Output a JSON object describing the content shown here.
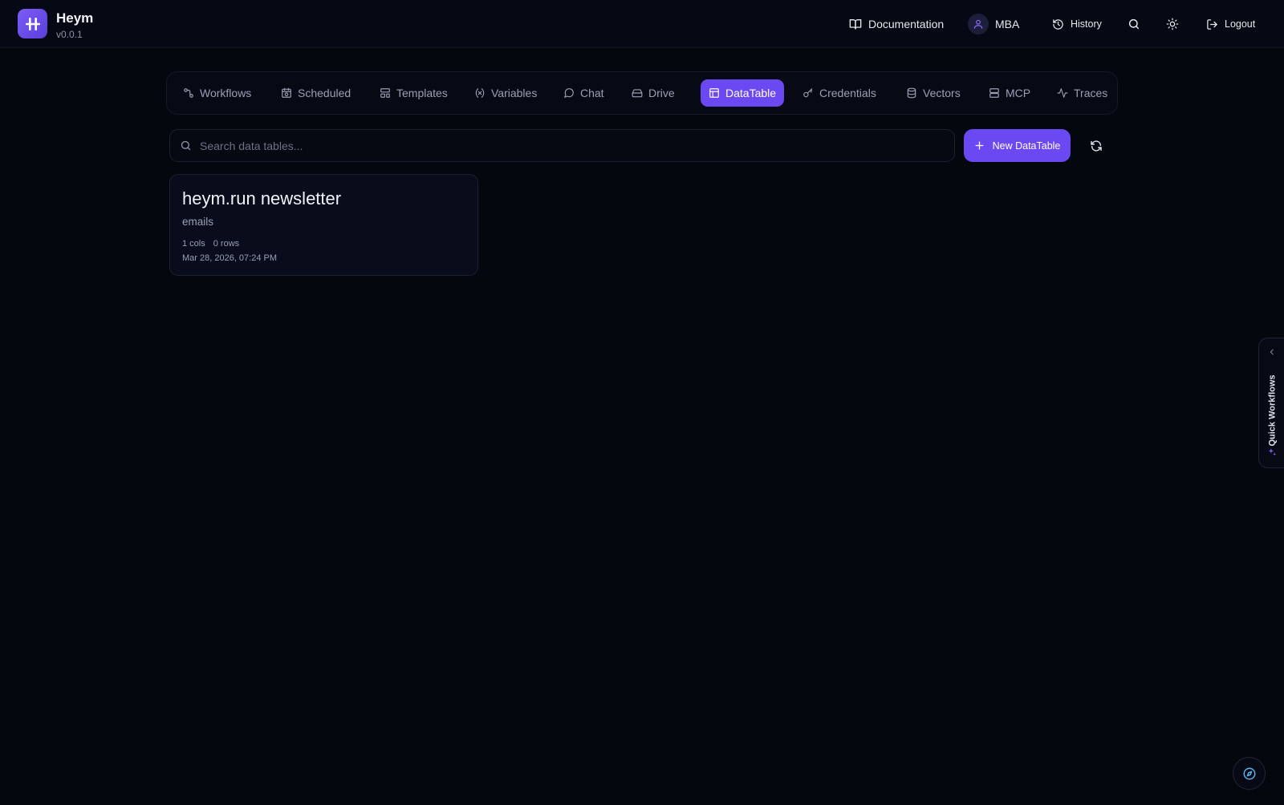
{
  "app": {
    "name": "Heym",
    "version": "v0.0.1"
  },
  "header": {
    "documentation": "Documentation",
    "user": "MBA",
    "history": "History",
    "logout": "Logout"
  },
  "tabs": [
    {
      "label": "Workflows",
      "icon": "workflow-icon"
    },
    {
      "label": "Scheduled",
      "icon": "calendar-clock-icon"
    },
    {
      "label": "Templates",
      "icon": "layout-template-icon"
    },
    {
      "label": "Variables",
      "icon": "variable-icon"
    },
    {
      "label": "Chat",
      "icon": "chat-bubble-icon"
    },
    {
      "label": "Drive",
      "icon": "hard-drive-icon"
    },
    {
      "label": "DataTable",
      "icon": "table-icon",
      "active": true
    },
    {
      "label": "Credentials",
      "icon": "key-icon"
    },
    {
      "label": "Vectors",
      "icon": "database-icon"
    },
    {
      "label": "MCP",
      "icon": "server-icon"
    },
    {
      "label": "Traces",
      "icon": "activity-icon"
    }
  ],
  "search": {
    "placeholder": "Search data tables...",
    "value": ""
  },
  "new_button": "New DataTable",
  "tables": [
    {
      "name": "heym.run newsletter",
      "description": "emails",
      "cols": "1 cols",
      "rows": "0 rows",
      "updated": "Mar 28, 2026, 07:24 PM"
    }
  ],
  "quick_workflows": "Quick Workflows",
  "colors": {
    "accent": "#6a49f2",
    "background": "#05070f"
  }
}
